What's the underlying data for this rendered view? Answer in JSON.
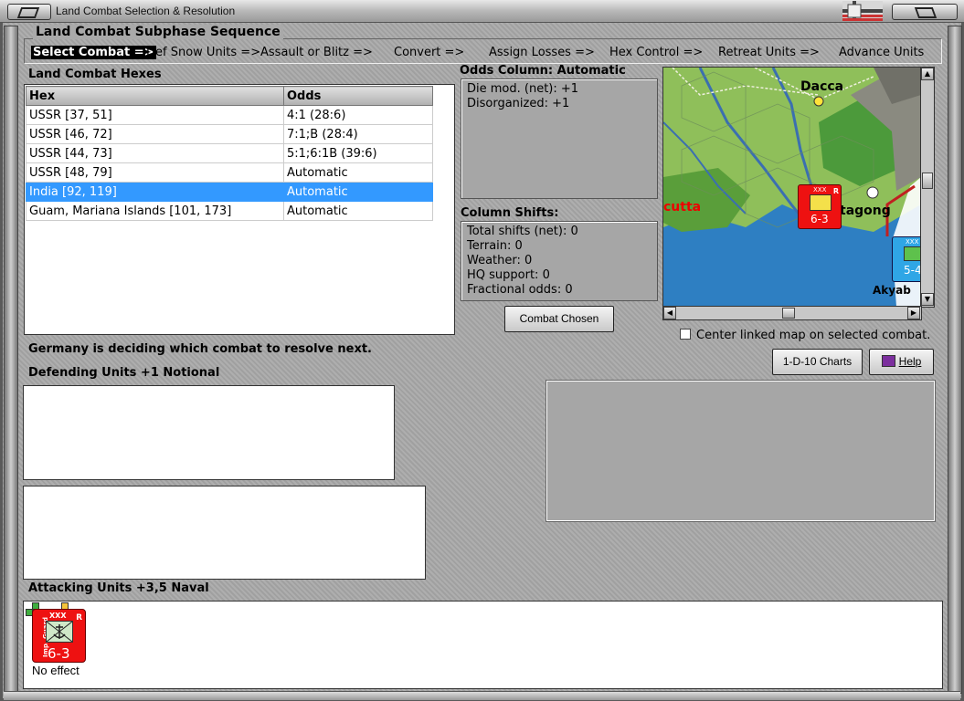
{
  "window": {
    "title": "Land Combat Selection & Resolution"
  },
  "sequence": {
    "legend": "Land Combat Subphase Sequence",
    "steps": [
      "Select Combat =>",
      "Def Snow Units =>",
      "Assault or Blitz =>",
      "Convert =>",
      "Assign Losses =>",
      "Hex Control =>",
      "Retreat Units =>",
      "Advance Units"
    ],
    "active_index": 0
  },
  "hex_list": {
    "heading": "Land Combat Hexes",
    "columns": [
      "Hex",
      "Odds"
    ],
    "rows": [
      {
        "hex": "USSR [37, 51]",
        "odds": "4:1 (28:6)"
      },
      {
        "hex": "USSR [46, 72]",
        "odds": "7:1;B (28:4)"
      },
      {
        "hex": "USSR [44, 73]",
        "odds": "5:1;6:1B (39:6)"
      },
      {
        "hex": "USSR [48, 79]",
        "odds": "Automatic"
      },
      {
        "hex": "India [92, 119]",
        "odds": "Automatic"
      },
      {
        "hex": "Guam, Mariana Islands [101, 173]",
        "odds": "Automatic"
      }
    ],
    "selected_index": 4
  },
  "odds_column": {
    "heading": "Odds Column: Automatic",
    "lines": [
      "Die mod. (net): +1",
      "Disorganized: +1"
    ]
  },
  "column_shifts": {
    "heading": "Column Shifts:",
    "lines": [
      "Total shifts (net): 0",
      "Terrain: 0",
      "Weather: 0",
      "HQ support: 0",
      "Fractional odds: 0"
    ]
  },
  "buttons": {
    "combat_chosen": "Combat Chosen",
    "charts": "1-D-10 Charts",
    "help": "Help"
  },
  "map": {
    "labels": {
      "dacca": "Dacca",
      "calcutta": "cutta",
      "chittagong": "tagong",
      "akyab": "Akyab"
    },
    "unit": {
      "value": "6-3",
      "size": "XXX",
      "tag": "R"
    },
    "unit2": {
      "value": "5-4",
      "size": "XXX"
    },
    "colors": {
      "sea": "#2e7fc2",
      "land": "#8fbf5a",
      "mountain": "#8a8a80",
      "forest": "#4c9a3b",
      "unit": "#e11111"
    }
  },
  "center_linked_label": "Center linked map on selected combat.",
  "status_message": "Germany is deciding which combat to resolve next.",
  "defending": {
    "heading": "Defending Units +1 Notional"
  },
  "attacking": {
    "heading": "Attacking Units +3,5 Naval",
    "unit": {
      "value": "6-3",
      "size": "XXX",
      "tag": "R",
      "name": "Imp. Guard",
      "result": "No effect"
    }
  }
}
